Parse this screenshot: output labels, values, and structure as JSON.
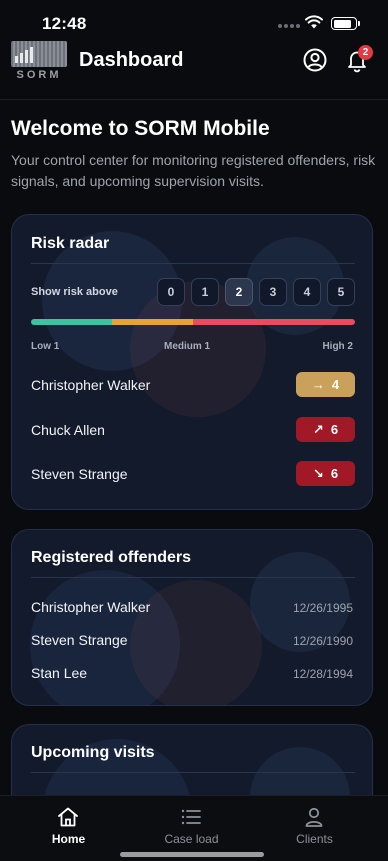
{
  "status_bar": {
    "time": "12:48"
  },
  "header": {
    "logo_text": "SORM",
    "title": "Dashboard",
    "profile_icon": "user-circle-icon",
    "bell_icon": "bell-icon",
    "notification_count": "2"
  },
  "welcome": {
    "title": "Welcome to SORM Mobile",
    "subtitle": "Your control center for monitoring registered offenders, risk signals, and upcoming supervision visits."
  },
  "risk_radar": {
    "title": "Risk radar",
    "filter_label": "Show risk above",
    "levels": [
      "0",
      "1",
      "2",
      "3",
      "4",
      "5"
    ],
    "selected_level": "2",
    "bar_colors": [
      "#3cc3a0",
      "#e7a23a",
      "#e84b63"
    ],
    "bar_fractions": [
      0.25,
      0.25,
      0.5
    ],
    "scale": {
      "low": "Low 1",
      "medium": "Medium 1",
      "high": "High 2"
    },
    "rows": [
      {
        "name": "Christopher Walker",
        "trend_icon": "arrow-right-icon",
        "trend": "→",
        "score": "4",
        "color": "#c9a15a"
      },
      {
        "name": "Chuck Allen",
        "trend_icon": "arrow-up-right-icon",
        "trend": "↗",
        "score": "6",
        "color": "#a11826"
      },
      {
        "name": "Steven Strange",
        "trend_icon": "arrow-down-right-icon",
        "trend": "↘",
        "score": "6",
        "color": "#a11826"
      }
    ]
  },
  "registered_offenders": {
    "title": "Registered offenders",
    "rows": [
      {
        "name": "Christopher Walker",
        "date": "12/26/1995"
      },
      {
        "name": "Steven Strange",
        "date": "12/26/1990"
      },
      {
        "name": "Stan Lee",
        "date": "12/28/1994"
      }
    ]
  },
  "upcoming_visits": {
    "title": "Upcoming visits"
  },
  "tabbar": {
    "tabs": [
      {
        "label": "Home",
        "icon": "home-icon",
        "active": true
      },
      {
        "label": "Case load",
        "icon": "list-icon",
        "active": false
      },
      {
        "label": "Clients",
        "icon": "person-icon",
        "active": false
      }
    ]
  }
}
